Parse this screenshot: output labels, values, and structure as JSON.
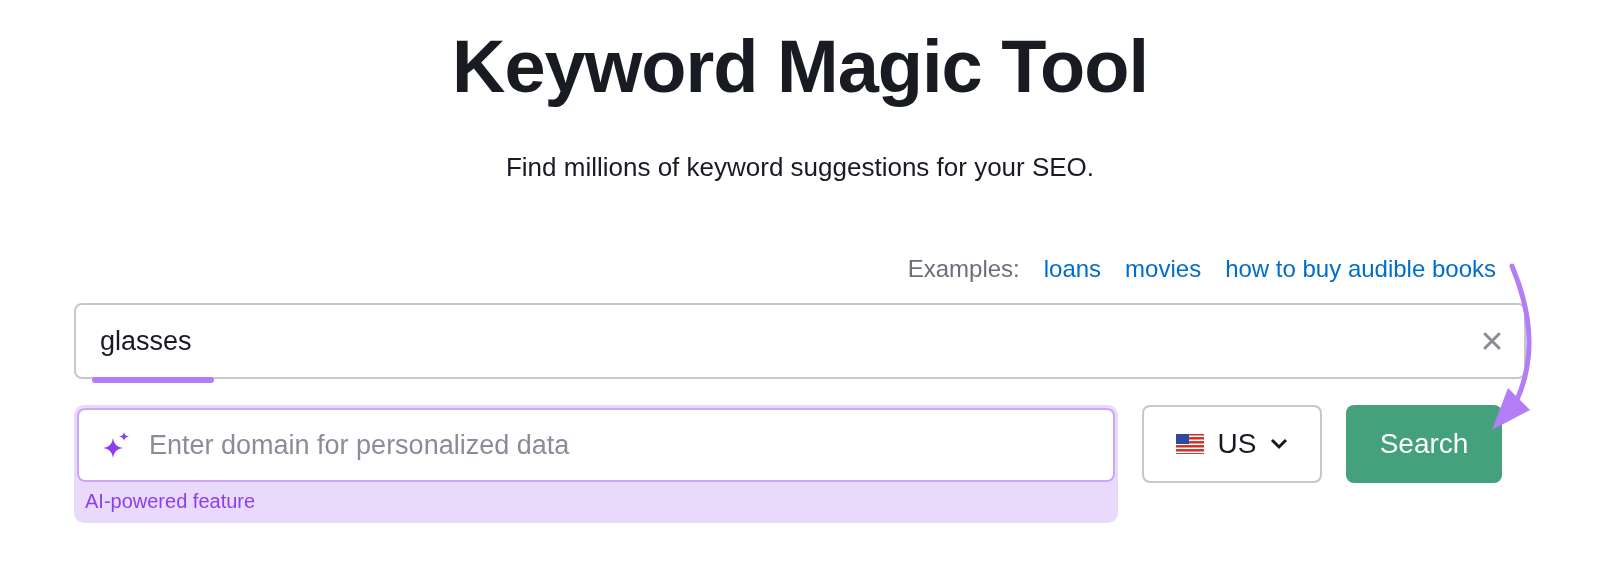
{
  "title": "Keyword Magic Tool",
  "subtitle": "Find millions of keyword suggestions for your SEO.",
  "examples": {
    "label": "Examples:",
    "links": [
      "loans",
      "movies",
      "how to buy audible books"
    ]
  },
  "keyword_field": {
    "value": "glasses"
  },
  "domain_field": {
    "placeholder": "Enter domain for personalized data",
    "note": "AI-powered feature"
  },
  "country_select": {
    "value": "US"
  },
  "search_button": {
    "label": "Search"
  }
}
